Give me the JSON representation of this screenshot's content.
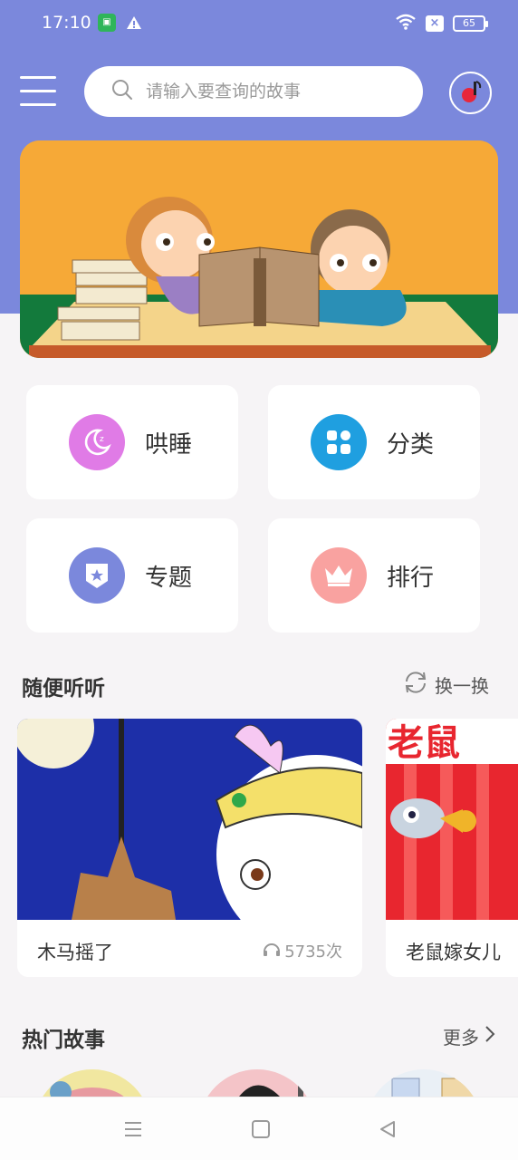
{
  "status_bar": {
    "time": "17:10",
    "battery": "65"
  },
  "search": {
    "placeholder": "请输入要查询的故事"
  },
  "features": [
    {
      "label": "哄睡",
      "color": "#e07be6"
    },
    {
      "label": "分类",
      "color": "#1f9fe0"
    },
    {
      "label": "专题",
      "color": "#7b88dc"
    },
    {
      "label": "排行",
      "color": "#f9a2a0"
    }
  ],
  "random_section": {
    "title": "随便听听",
    "action": "换一换"
  },
  "random_cards": [
    {
      "title": "木马摇了",
      "plays": "5735次"
    },
    {
      "title": "老鼠嫁女儿",
      "plays": ""
    }
  ],
  "hot_section": {
    "title": "热门故事",
    "action": "更多"
  },
  "colors": {
    "header": "#7b88dc",
    "banner": "#f6a937",
    "background": "#f6f4f6"
  }
}
